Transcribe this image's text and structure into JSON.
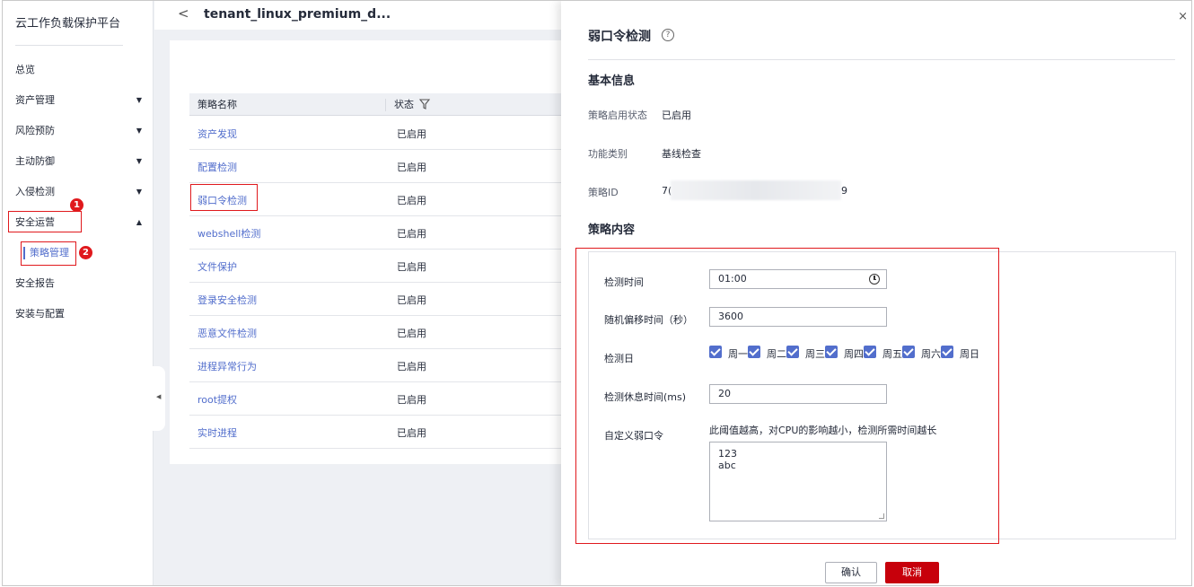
{
  "sidebar": {
    "app_title": "云工作负载保护平台",
    "items": [
      {
        "label": "总览",
        "chevron": ""
      },
      {
        "label": "资产管理",
        "chevron": "▼"
      },
      {
        "label": "风险预防",
        "chevron": "▼"
      },
      {
        "label": "主动防御",
        "chevron": "▼"
      },
      {
        "label": "入侵检测",
        "chevron": "▼"
      },
      {
        "label": "安全运营",
        "chevron": "▲"
      },
      {
        "label": "安全报告",
        "chevron": ""
      },
      {
        "label": "安装与配置",
        "chevron": ""
      }
    ],
    "sub_item": "策略管理",
    "badge1": "1",
    "badge2": "2",
    "collapse_icon": "◀"
  },
  "header": {
    "back_icon": "<",
    "title": "tenant_linux_premium_d..."
  },
  "table": {
    "col_name": "策略名称",
    "col_status": "状态",
    "rows": [
      {
        "name": "资产发现",
        "status": "已启用"
      },
      {
        "name": "配置检测",
        "status": "已启用"
      },
      {
        "name": "弱口令检测",
        "status": "已启用"
      },
      {
        "name": "webshell检测",
        "status": "已启用"
      },
      {
        "name": "文件保护",
        "status": "已启用"
      },
      {
        "name": "登录安全检测",
        "status": "已启用"
      },
      {
        "name": "恶意文件检测",
        "status": "已启用"
      },
      {
        "name": "进程异常行为",
        "status": "已启用"
      },
      {
        "name": "root提权",
        "status": "已启用"
      },
      {
        "name": "实时进程",
        "status": "已启用"
      }
    ]
  },
  "drawer": {
    "title": "弱口令检测",
    "help_icon": "?",
    "close_icon": "×",
    "basic_info_title": "基本信息",
    "status_label": "策略启用状态",
    "status_value": "已启用",
    "type_label": "功能类别",
    "type_value": "基线检查",
    "id_label": "策略ID",
    "id_value_start": "7(",
    "id_value_end": "9",
    "content_title": "策略内容",
    "form": {
      "time_label": "检测时间",
      "time_value": "01:00",
      "offset_label": "随机偏移时间（秒）",
      "offset_value": "3600",
      "days_label": "检测日",
      "days": [
        "周一",
        "周二",
        "周三",
        "周四",
        "周五",
        "周六",
        "周日"
      ],
      "rest_label": "检测休息时间(ms)",
      "rest_value": "20",
      "custom_label": "自定义弱口令",
      "hint": "此阈值越高，对CPU的影响越小，检测所需时间越长",
      "passwords": [
        "123",
        "abc"
      ]
    },
    "confirm": "确认",
    "cancel": "取消"
  }
}
